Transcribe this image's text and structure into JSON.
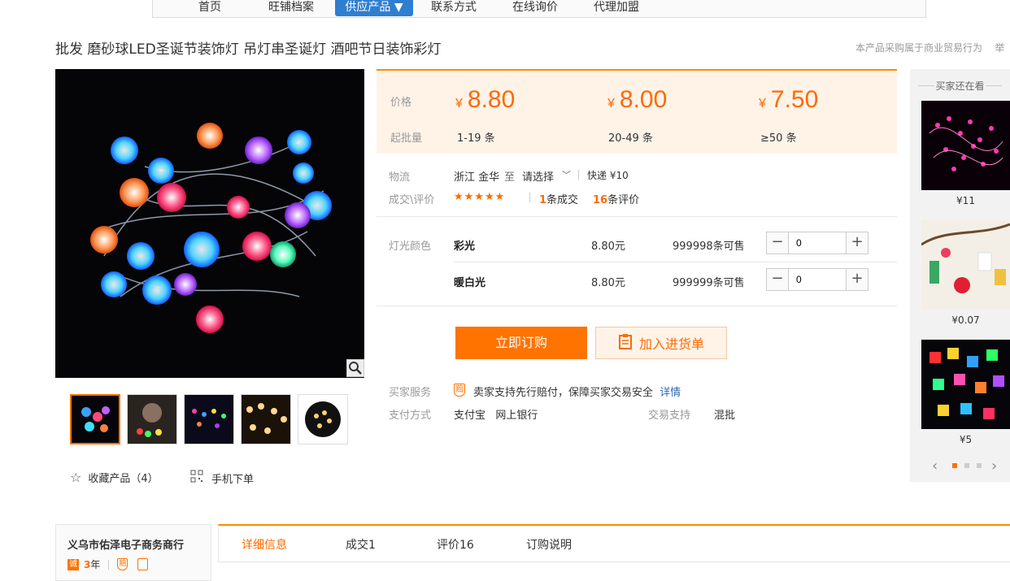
{
  "nav": {
    "items": [
      {
        "label": "首页"
      },
      {
        "label": "旺铺档案"
      },
      {
        "label": "供应产品 ▼"
      },
      {
        "label": "联系方式"
      },
      {
        "label": "在线询价"
      },
      {
        "label": "代理加盟"
      }
    ]
  },
  "product": {
    "title": "批发 磨砂球LED圣诞节装饰灯 吊灯串圣诞灯 酒吧节日装饰彩灯",
    "notice": "本产品采购属于商业贸易行为",
    "notice_extra": "举"
  },
  "gallery": {
    "favorite_label": "收藏产品（4）",
    "mobile_label": "手机下单"
  },
  "pricing": {
    "price_label": "价格",
    "min_label": "起批量",
    "currency": "¥",
    "tiers": [
      {
        "price": "8.80",
        "qty": "1-19 条"
      },
      {
        "price": "8.00",
        "qty": "20-49 条"
      },
      {
        "price": "7.50",
        "qty": "≥50 条"
      }
    ]
  },
  "logistics": {
    "label": "物流",
    "origin": "浙江 金华",
    "to": "至",
    "dest": "请选择",
    "express": "快递 ¥10"
  },
  "deals": {
    "label": "成交\\评价",
    "stars": "★★★★★",
    "deal_count": "1",
    "deal_text": "条成交",
    "review_count": "16",
    "review_text": "条评价"
  },
  "sku": {
    "label": "灯光颜色",
    "items": [
      {
        "name": "彩光",
        "price": "8.80元",
        "stock": "999998条可售",
        "qty": "0"
      },
      {
        "name": "暖白光",
        "price": "8.80元",
        "stock": "999999条可售",
        "qty": "0"
      }
    ]
  },
  "actions": {
    "buy_label": "立即订购",
    "cart_label": "加入进货单"
  },
  "service": {
    "label": "买家服务",
    "text": "卖家支持先行赔付，保障买家交易安全",
    "link": "详情",
    "icon_text": "赔"
  },
  "payment": {
    "label": "支付方式",
    "methods": "支付宝   网上银行",
    "trade_label": "交易支持",
    "trade_value": "混批"
  },
  "sidebar": {
    "title": "买家还在看",
    "items": [
      {
        "price": "¥11"
      },
      {
        "price": "¥0.07"
      },
      {
        "price": "¥5"
      }
    ]
  },
  "shop": {
    "name": "义乌市佑泽电子商务商行",
    "years": "3",
    "years_unit": "年"
  },
  "tabs": [
    {
      "label": "详细信息"
    },
    {
      "label": "成交1"
    },
    {
      "label": "评价16"
    },
    {
      "label": "订购说明"
    }
  ],
  "colors": {
    "accent": "#ff7300",
    "nav_active": "#2f7ecf",
    "price_bg": "#fff3e8"
  }
}
